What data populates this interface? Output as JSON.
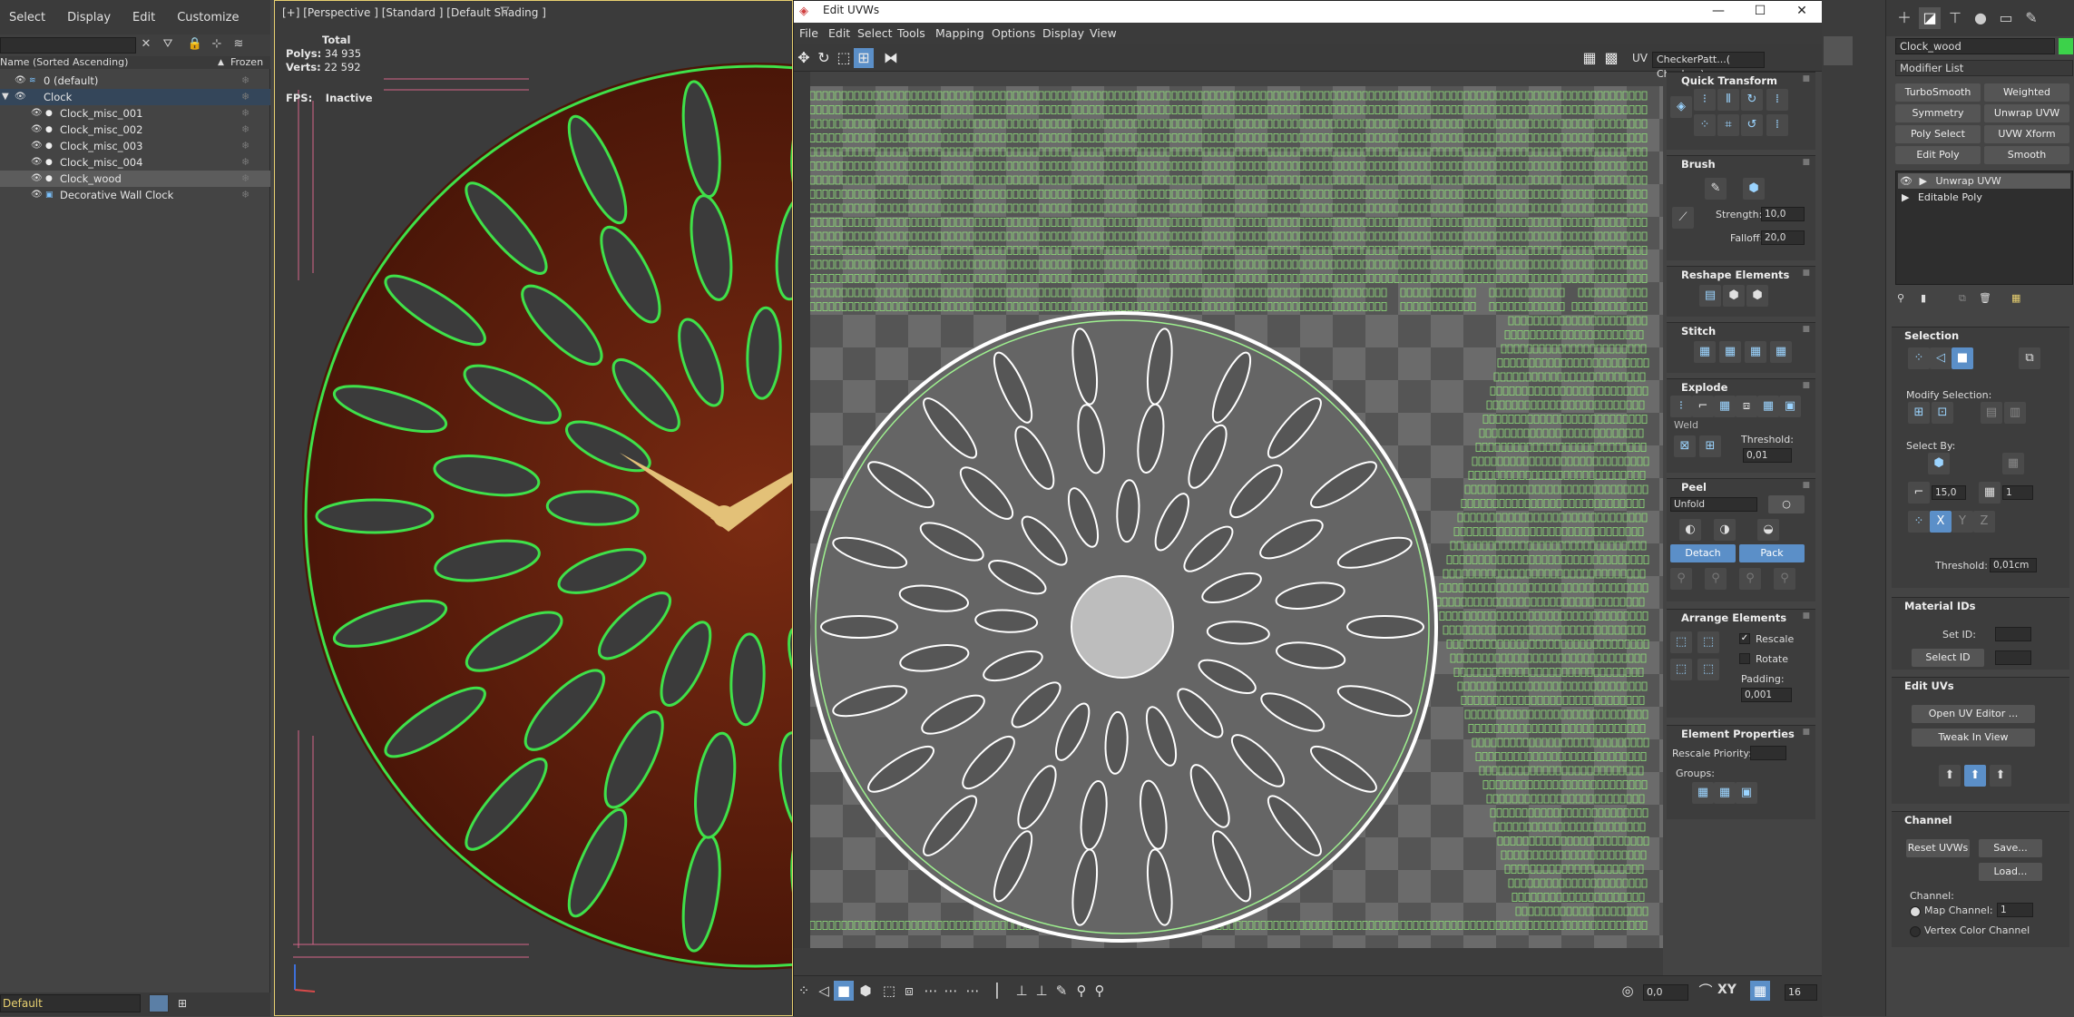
{
  "scene_explorer": {
    "menu": [
      "Select",
      "Display",
      "Edit",
      "Customize"
    ],
    "header_name": "Name (Sorted Ascending)",
    "header_frozen": "Frozen",
    "rows": [
      {
        "label": "0 (default)",
        "indent": 1
      },
      {
        "label": "Clock",
        "indent": 1
      },
      {
        "label": "Clock_misc_001",
        "indent": 2
      },
      {
        "label": "Clock_misc_002",
        "indent": 2
      },
      {
        "label": "Clock_misc_003",
        "indent": 2
      },
      {
        "label": "Clock_misc_004",
        "indent": 2
      },
      {
        "label": "Clock_wood",
        "indent": 2
      },
      {
        "label": "Decorative Wall Clock",
        "indent": 2
      }
    ],
    "layer": "Default"
  },
  "viewport": {
    "label": "[+] [Perspective ] [Standard ] [Default Shading ]",
    "stats_total": "Total",
    "polys_label": "Polys:",
    "polys_value": "34 935",
    "verts_label": "Verts:",
    "verts_value": "22 592",
    "fps_label": "FPS:",
    "fps_value": "Inactive"
  },
  "uv_editor": {
    "title": "Edit UVWs",
    "menu": [
      "File",
      "Edit",
      "Select",
      "Tools",
      "Mapping",
      "Options",
      "Display",
      "View"
    ],
    "uv_label": "UV",
    "checker": "CheckerPatt...( Checker )",
    "coord_value": "0,0",
    "zoom_value": "16",
    "xy_label": "XY",
    "panel": {
      "quick_transform": "Quick Transform",
      "brush": "Brush",
      "strength_label": "Strength:",
      "strength_value": "10,0",
      "falloff_label": "Falloff:",
      "falloff_value": "20,0",
      "reshape": "Reshape Elements",
      "stitch": "Stitch",
      "explode": "Explode",
      "weld_label": "Weld",
      "threshold_label": "Threshold:",
      "threshold_value": "0,01",
      "peel": "Peel",
      "unfold": "Unfold",
      "detach": "Detach",
      "pack": "Pack",
      "arrange": "Arrange Elements",
      "rescale": "Rescale",
      "rotate": "Rotate",
      "padding_label": "Padding:",
      "padding_value": "0,001",
      "element_props": "Element Properties",
      "rescale_priority": "Rescale Priority:",
      "groups": "Groups:"
    }
  },
  "command_panel": {
    "object_name": "Clock_wood",
    "modifier_list": "Modifier List",
    "buttons": [
      "TurboSmooth",
      "Weighted Normals",
      "Symmetry",
      "Unwrap UVW",
      "Poly Select",
      "UVW Xform",
      "Edit Poly",
      "Smooth"
    ],
    "stack": [
      "Unwrap UVW",
      "Editable Poly"
    ],
    "selection_title": "Selection",
    "modify_selection": "Modify Selection:",
    "select_by": "Select By:",
    "angle_value": "15,0",
    "count_value": "1",
    "threshold_label": "Threshold:",
    "threshold_value": "0,01cm",
    "material_ids_title": "Material IDs",
    "set_id": "Set ID:",
    "select_id": "Select ID",
    "edit_uvs_title": "Edit UVs",
    "open_uv_editor": "Open UV Editor ...",
    "tweak_in_view": "Tweak In View",
    "channel_title": "Channel",
    "reset_uvws": "Reset UVWs",
    "save": "Save...",
    "load": "Load...",
    "channel_label": "Channel:",
    "map_channel": "Map Channel:",
    "map_channel_value": "1",
    "vertex_color_channel": "Vertex Color Channel"
  }
}
